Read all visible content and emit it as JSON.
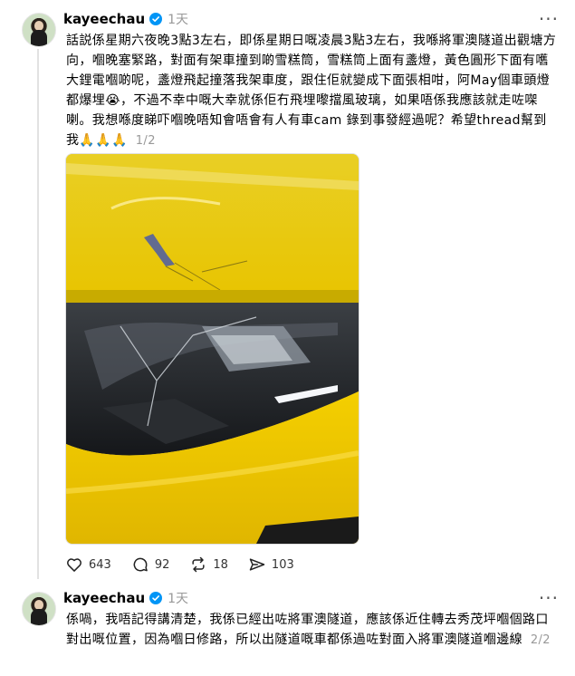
{
  "posts": [
    {
      "username": "kayeechau",
      "time": "1天",
      "text": "話説係星期六夜晚3點3左右，即係星期日嘅凌晨3點3左右，我喺將軍澳隧道出觀塘方向，嗰晚塞緊路，對面有架車撞到啲雪糕筒，雪糕筒上面有盞燈，黃色圓形下面有嚿大鋰電嗰啲呢，盞燈飛起撞落我架車度，跟住佢就變成下面張相咁，阿May個車頭燈都爆埋😭，不過不幸中嘅大幸就係佢冇飛埋嚟擋風玻璃，如果唔係我應該就走咗㗎喇。我想喺度睇吓嗰晚唔知會唔會有人有車cam 錄到事發經過呢？希望thread幫到我🙏🙏🙏",
      "pager": "1/2",
      "likes": "643",
      "comments": "92",
      "reposts": "18",
      "shares": "103"
    },
    {
      "username": "kayeechau",
      "time": "1天",
      "text": "係喎，我唔記得講清楚，我係已經出咗將軍澳隧道，應該係近住轉去秀茂坪嗰個路口對出嘅位置，因為嗰日修路，所以出隧道嘅車都係過咗對面入將軍澳隧道嗰邊線",
      "pager": "2/2"
    }
  ],
  "icons": {
    "more": "more-dots-icon",
    "verified": "verified-badge-icon",
    "like": "heart-icon",
    "comment": "comment-bubble-icon",
    "repost": "repost-arrows-icon",
    "share": "send-arrow-icon"
  },
  "colors": {
    "verified": "#0095f6",
    "car": "#f0c800"
  }
}
